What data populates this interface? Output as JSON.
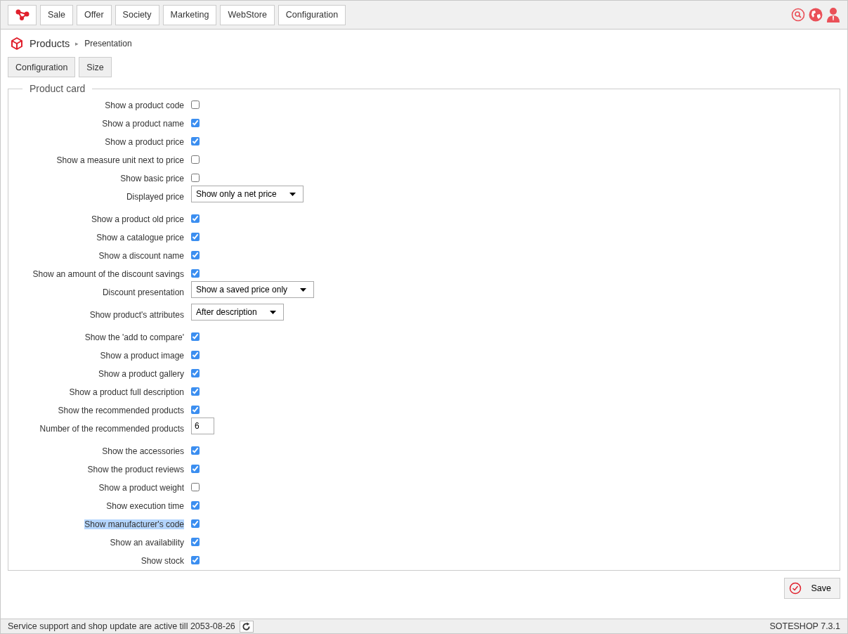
{
  "top_menu": [
    {
      "label": "Sale"
    },
    {
      "label": "Offer"
    },
    {
      "label": "Society"
    },
    {
      "label": "Marketing"
    },
    {
      "label": "WebStore"
    },
    {
      "label": "Configuration"
    }
  ],
  "breadcrumb": {
    "section": "Products",
    "separator": "▸",
    "page": "Presentation"
  },
  "sub_tabs": [
    {
      "label": "Configuration"
    },
    {
      "label": "Size"
    }
  ],
  "fieldset": {
    "legend": "Product card",
    "rows": [
      {
        "kind": "checkbox",
        "label": "Show a product code",
        "checked": false
      },
      {
        "kind": "checkbox",
        "label": "Show a product name",
        "checked": true
      },
      {
        "kind": "checkbox",
        "label": "Show a product price",
        "checked": true
      },
      {
        "kind": "checkbox",
        "label": "Show a measure unit next to price",
        "checked": false
      },
      {
        "kind": "checkbox",
        "label": "Show basic price",
        "checked": false
      },
      {
        "kind": "select",
        "label": "Displayed price",
        "value": "Show only a net price"
      },
      {
        "kind": "checkbox",
        "label": "Show a product old price",
        "checked": true
      },
      {
        "kind": "checkbox",
        "label": "Show a catalogue price",
        "checked": true
      },
      {
        "kind": "checkbox",
        "label": "Show a discount name",
        "checked": true
      },
      {
        "kind": "checkbox",
        "label": "Show an amount of the discount savings",
        "checked": true
      },
      {
        "kind": "select",
        "label": "Discount presentation",
        "value": "Show a saved price only"
      },
      {
        "kind": "select",
        "label": "Show product's attributes",
        "value": "After description"
      },
      {
        "kind": "checkbox",
        "label": "Show the 'add to compare'",
        "checked": true
      },
      {
        "kind": "checkbox",
        "label": "Show a product image",
        "checked": true
      },
      {
        "kind": "checkbox",
        "label": "Show a product gallery",
        "checked": true
      },
      {
        "kind": "checkbox",
        "label": "Show a product full description",
        "checked": true
      },
      {
        "kind": "checkbox",
        "label": "Show the recommended products",
        "checked": true
      },
      {
        "kind": "number",
        "label": "Number of the recommended products",
        "value": "6"
      },
      {
        "kind": "checkbox",
        "label": "Show the accessories",
        "checked": true
      },
      {
        "kind": "checkbox",
        "label": "Show the product reviews",
        "checked": true
      },
      {
        "kind": "checkbox",
        "label": "Show a product weight",
        "checked": false
      },
      {
        "kind": "checkbox",
        "label": "Show execution time",
        "checked": true
      },
      {
        "kind": "checkbox",
        "label": "Show manufacturer's code",
        "checked": true,
        "highlighted": true
      },
      {
        "kind": "checkbox",
        "label": "Show an availability",
        "checked": true
      },
      {
        "kind": "checkbox",
        "label": "Show stock",
        "checked": true
      }
    ]
  },
  "save_button": {
    "label": "Save"
  },
  "status_bar": {
    "message": "Service support and shop update are active till 2053-08-26",
    "version": "SOTESHOP 7.3.1"
  }
}
